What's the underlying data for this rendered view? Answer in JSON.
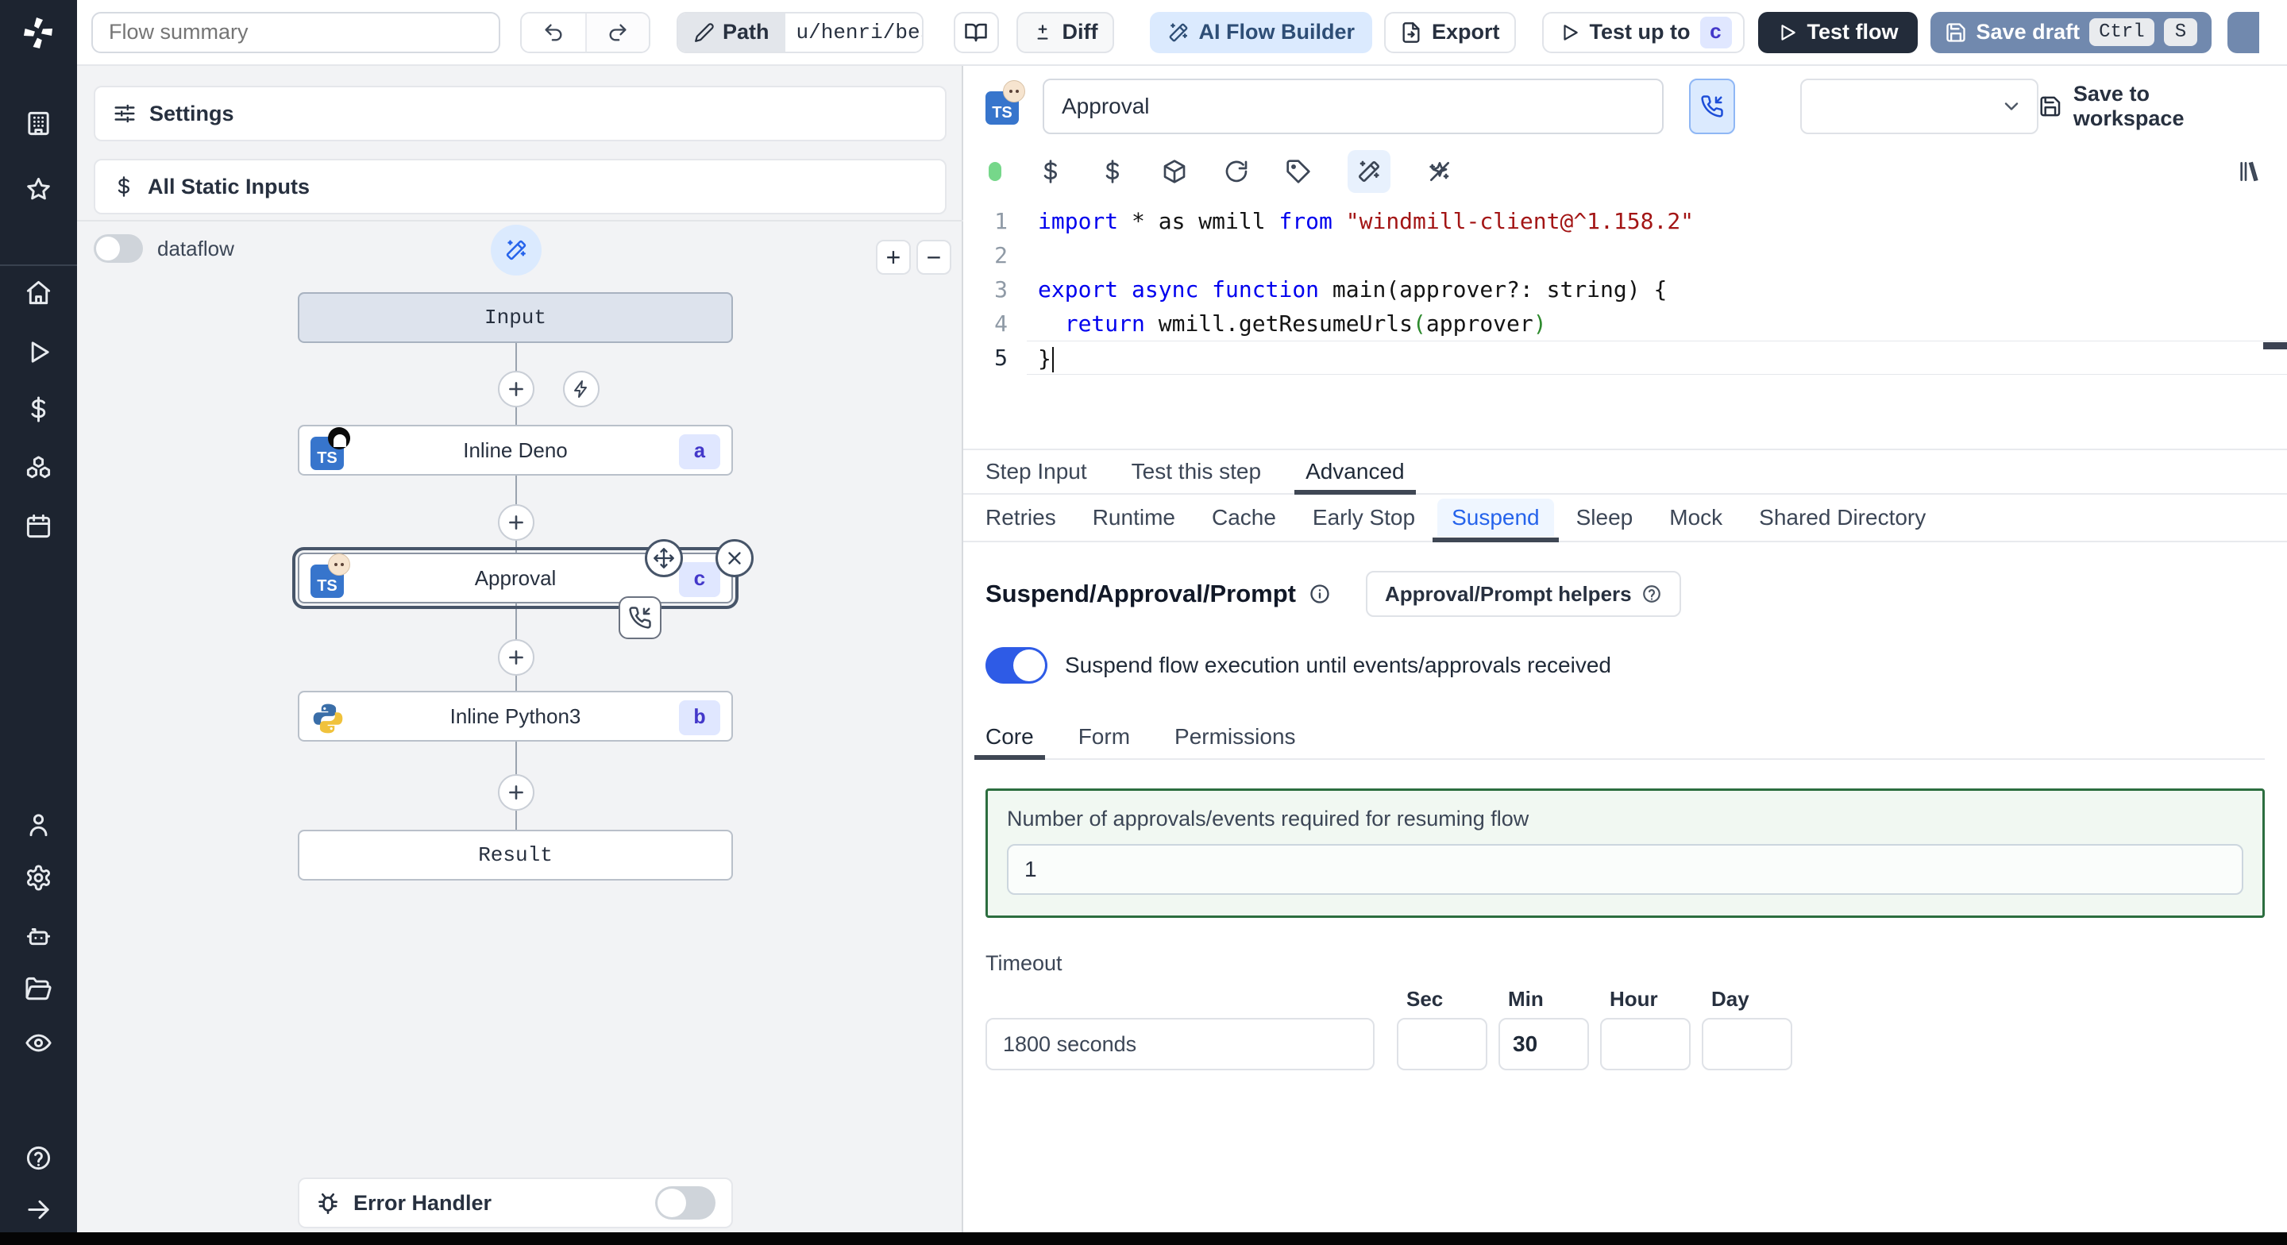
{
  "colors": {
    "accent_blue": "#2e5be6",
    "badge_bg": "#e0e7ff",
    "badge_text": "#4338ca",
    "save_draft_bg": "#7189ae",
    "dark_button_bg": "#232c3a",
    "ai_builder_bg": "#dbeafe",
    "green_border": "#2c6e3f",
    "sidebar_bg": "#1d2430",
    "graph_bg": "#f2f3f5"
  },
  "sidebar": {
    "icons": [
      "windmill-logo",
      "building",
      "star",
      "home",
      "runs-play",
      "variables-dollar",
      "resources-cubes",
      "schedules-calendar",
      "user",
      "settings-gear",
      "workers-robot",
      "folders",
      "audit-eye",
      "help-circle",
      "expand-arrow-right"
    ]
  },
  "topbar": {
    "flow_summary_placeholder": "Flow summary",
    "path_label": "Path",
    "path_value": "u/henri/bes",
    "diff_label": "Diff",
    "ai_flow_builder_label": "AI Flow Builder",
    "export_label": "Export",
    "test_up_to_label": "Test up to",
    "test_up_to_badge": "c",
    "test_flow_label": "Test flow",
    "save_draft_label": "Save draft",
    "save_draft_kbd_1": "Ctrl",
    "save_draft_kbd_2": "S"
  },
  "graph": {
    "settings_label": "Settings",
    "static_inputs_label": "All Static Inputs",
    "dataflow_label": "dataflow",
    "zoom_in_label": "+",
    "zoom_out_label": "−",
    "nodes": [
      {
        "label": "Input"
      },
      {
        "label": "Inline Deno",
        "badge": "a"
      },
      {
        "label": "Approval",
        "badge": "c"
      },
      {
        "label": "Inline Python3",
        "badge": "b"
      },
      {
        "label": "Result"
      }
    ],
    "error_handler_label": "Error Handler"
  },
  "step": {
    "name_value": "Approval",
    "save_to_workspace_label": "Save to workspace",
    "code": {
      "numbers": [
        "1",
        "2",
        "3",
        "4",
        "5"
      ],
      "lines": [
        [
          {
            "c": "kw",
            "t": "import"
          },
          {
            "c": "pl",
            "t": " * as wmill "
          },
          {
            "c": "kw",
            "t": "from"
          },
          {
            "c": "pl",
            "t": " "
          },
          {
            "c": "st",
            "t": "\"windmill-client@^1.158.2\""
          }
        ],
        [],
        [
          {
            "c": "kw",
            "t": "export"
          },
          {
            "c": "pl",
            "t": " "
          },
          {
            "c": "kw",
            "t": "async"
          },
          {
            "c": "pl",
            "t": " "
          },
          {
            "c": "kw",
            "t": "function"
          },
          {
            "c": "pl",
            "t": " main(approver?: string) {"
          }
        ],
        [
          {
            "c": "pl",
            "t": "  "
          },
          {
            "c": "kw",
            "t": "return"
          },
          {
            "c": "pl",
            "t": " wmill.getResumeUrls"
          },
          {
            "c": "br2",
            "t": "("
          },
          {
            "c": "pl",
            "t": "approver"
          },
          {
            "c": "br2",
            "t": ")"
          }
        ],
        [
          {
            "c": "pl",
            "t": "}"
          }
        ]
      ]
    },
    "tabs": [
      {
        "label": "Step Input"
      },
      {
        "label": "Test this step"
      },
      {
        "label": "Advanced"
      }
    ],
    "subtabs": [
      {
        "label": "Retries"
      },
      {
        "label": "Runtime"
      },
      {
        "label": "Cache"
      },
      {
        "label": "Early Stop"
      },
      {
        "label": "Suspend"
      },
      {
        "label": "Sleep"
      },
      {
        "label": "Mock"
      },
      {
        "label": "Shared Directory"
      }
    ],
    "suspend": {
      "title": "Suspend/Approval/Prompt",
      "helpers_label": "Approval/Prompt helpers",
      "toggle_label": "Suspend flow execution until events/approvals received",
      "inner_tabs": [
        {
          "label": "Core"
        },
        {
          "label": "Form"
        },
        {
          "label": "Permissions"
        }
      ],
      "approvals_label": "Number of approvals/events required for resuming flow",
      "approvals_value": "1",
      "timeout_label": "Timeout",
      "timeout_value": "1800 seconds",
      "units": [
        {
          "label": "Sec",
          "value": ""
        },
        {
          "label": "Min",
          "value": "30"
        },
        {
          "label": "Hour",
          "value": ""
        },
        {
          "label": "Day",
          "value": ""
        }
      ]
    }
  }
}
